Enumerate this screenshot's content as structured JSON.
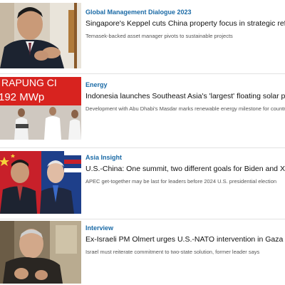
{
  "articles": [
    {
      "category": "Global Management Dialogue 2023",
      "headline": "Singapore's Keppel cuts China property focus in strategic refresh",
      "summary": "Temasek-backed asset manager pivots to sustainable projects",
      "image_subject": "man in suit gesturing"
    },
    {
      "category": "Energy",
      "headline": "Indonesia launches Southeast Asia's 'largest' floating solar plant",
      "summary": "Development with Abu Dhabi's Masdar marks renewable energy milestone for country",
      "image_subject": "officials in front of red banner",
      "image_text": [
        "RAPUNG CI",
        "192 MWp"
      ]
    },
    {
      "category": "Asia Insight",
      "headline": "U.S.-China: One summit, two different goals for Biden and Xi",
      "summary": "APEC get-together may be last for leaders before 2024 U.S. presidential election",
      "image_subject": "two leaders in front of flags"
    },
    {
      "category": "Interview",
      "headline": "Ex-Israeli PM Olmert urges U.S.-NATO intervention in Gaza after war",
      "summary": "Israel must reiterate commitment to two-state solution, former leader says",
      "image_subject": "elderly man speaking"
    }
  ],
  "colors": {
    "category": "#1a6aa6",
    "headline": "#111111",
    "summary": "#555555",
    "divider": "#e2e2e2",
    "banner_red": "#d8231f"
  }
}
